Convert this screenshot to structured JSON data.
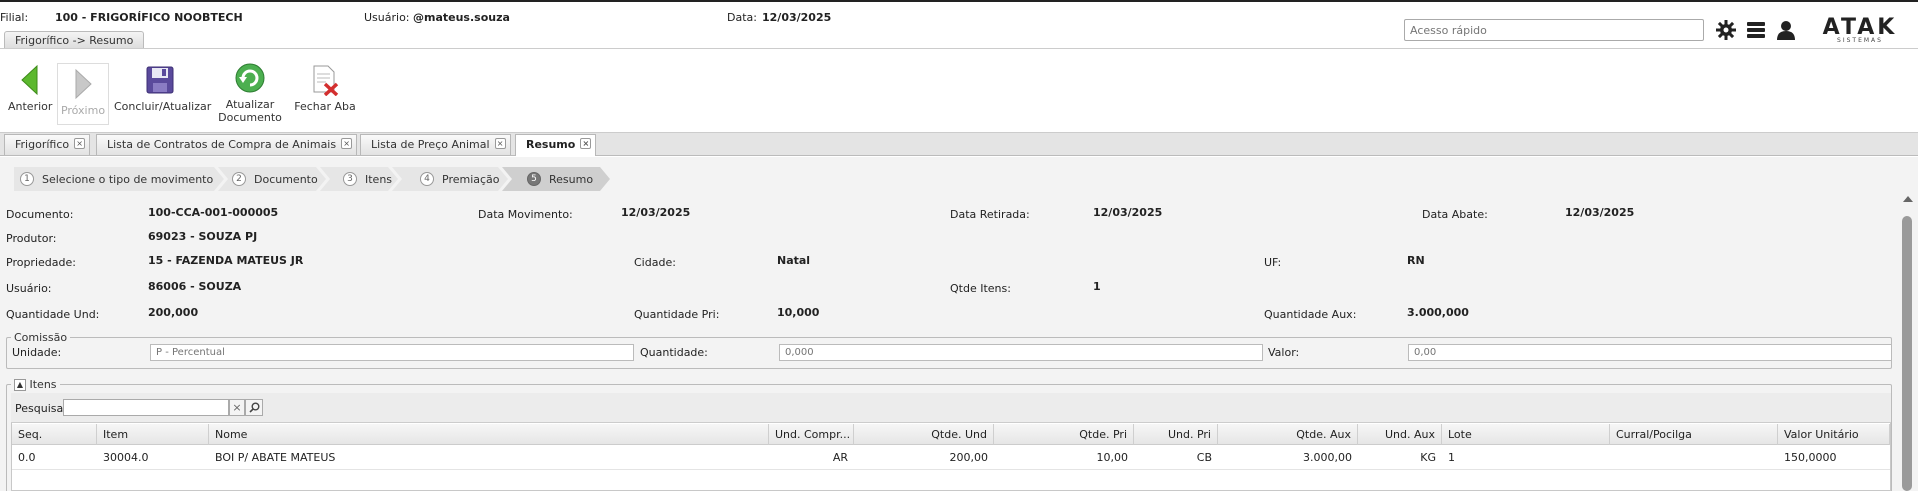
{
  "header": {
    "filial_label": "Filial:",
    "filial_value": "100 - FRIGORÍFICO NOOBTECH",
    "usuario_label": "Usuário:",
    "usuario_value": "@mateus.souza",
    "data_label": "Data:",
    "data_value": "12/03/2025",
    "quick_access_placeholder": "Acesso rápido",
    "brand": "ATAK",
    "brand_sub": "SISTEMAS"
  },
  "breadcrumb": "Frigorífico -> Resumo",
  "toolbar": {
    "anterior": "Anterior",
    "proximo": "Próximo",
    "concluir": "Concluir/Atualizar",
    "atualizar_1": "Atualizar",
    "atualizar_2": "Documento",
    "fechar": "Fechar Aba"
  },
  "tabs": [
    {
      "label": "Frigorífico"
    },
    {
      "label": "Lista de Contratos de Compra de Animais"
    },
    {
      "label": "Lista de Preço Animal"
    },
    {
      "label": "Resumo"
    }
  ],
  "steps": [
    {
      "num": "1",
      "label": "Selecione o tipo de movimento"
    },
    {
      "num": "2",
      "label": "Documento"
    },
    {
      "num": "3",
      "label": "Itens"
    },
    {
      "num": "4",
      "label": "Premiação"
    },
    {
      "num": "5",
      "label": "Resumo"
    }
  ],
  "resumo": {
    "documento_label": "Documento:",
    "documento": "100-CCA-001-000005",
    "data_mov_label": "Data Movimento:",
    "data_mov": "12/03/2025",
    "data_ret_label": "Data Retirada:",
    "data_ret": "12/03/2025",
    "data_abate_label": "Data Abate:",
    "data_abate": "12/03/2025",
    "produtor_label": "Produtor:",
    "produtor": "69023 - SOUZA PJ",
    "propriedade_label": "Propriedade:",
    "propriedade": "15 - FAZENDA MATEUS JR",
    "cidade_label": "Cidade:",
    "cidade": "Natal",
    "uf_label": "UF:",
    "uf": "RN",
    "usuario_label": "Usuário:",
    "usuario": "86006 - SOUZA",
    "qtde_itens_label": "Qtde Itens:",
    "qtde_itens": "1",
    "qtd_und_label": "Quantidade Und:",
    "qtd_und": "200,000",
    "qtd_pri_label": "Quantidade Pri:",
    "qtd_pri": "10,000",
    "qtd_aux_label": "Quantidade Aux:",
    "qtd_aux": "3.000,000"
  },
  "comissao": {
    "legend": "Comissão",
    "unidade_label": "Unidade:",
    "unidade_value": "P - Percentual",
    "quantidade_label": "Quantidade:",
    "quantidade_value": "0,000",
    "valor_label": "Valor:",
    "valor_value": "0,00"
  },
  "itens": {
    "legend": "Itens",
    "search_label": "Pesquisar",
    "columns": [
      "Seq.",
      "Item",
      "Nome",
      "Und. Compr...",
      "Qtde. Und",
      "Qtde. Pri",
      "Und. Pri",
      "Qtde. Aux",
      "Und. Aux",
      "Lote",
      "Curral/Pocilga",
      "Valor Unitário"
    ],
    "rows": [
      [
        "0.0",
        "30004.0",
        "BOI P/ ABATE MATEUS",
        "AR",
        "200,00",
        "10,00",
        "CB",
        "3.000,00",
        "KG",
        "1",
        "",
        "150,0000"
      ]
    ]
  }
}
